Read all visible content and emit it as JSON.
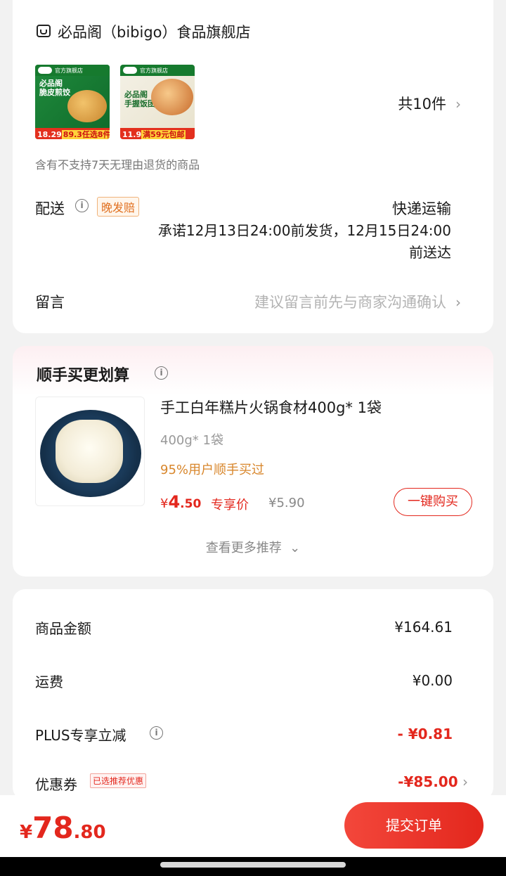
{
  "store": {
    "icon": "store-icon",
    "name": "必品阁（bibigo）食品旗舰店",
    "products": [
      {
        "header": "官方旗舰店",
        "title_line1": "必品阁",
        "title_line2": "脆皮煎饺",
        "price": "18.29",
        "promo": "89.3任选8件"
      },
      {
        "header": "官方旗舰店",
        "title_line1": "必品阁",
        "title_line2": "手握饭团",
        "price": "11.9",
        "promo": "满59元包邮"
      }
    ],
    "count": "共10件",
    "return_note": "含有不支持7天无理由退货的商品"
  },
  "delivery": {
    "label": "配送",
    "badge": "晚发赔",
    "method": "快递运输",
    "promise_line1": "承诺12月13日24:00前发货，12月15日24:00",
    "promise_line2": "前送达"
  },
  "message": {
    "label": "留言",
    "placeholder": "建议留言前先与商家沟通确认"
  },
  "recommend": {
    "title": "顺手买更划算",
    "item": {
      "name": "手工白年糕片火锅食材400g* 1袋",
      "spec": "400g* 1袋",
      "stat": "95%用户顺手买过",
      "currency": "¥",
      "price_int": "4",
      "price_dec": ".50",
      "exclusive_label": "专享价",
      "original_price": "¥5.90",
      "buy_label": "一键购买"
    },
    "more_label": "查看更多推荐"
  },
  "price_summary": {
    "goods_label": "商品金额",
    "goods_value": "¥164.61",
    "shipping_label": "运费",
    "shipping_value": "¥0.00",
    "plus_label": "PLUS专享立减",
    "plus_value": "- ¥0.81",
    "coupon_label": "优惠券",
    "coupon_badge": "已选推荐优惠",
    "coupon_value": "-¥85.00"
  },
  "footer": {
    "currency": "¥",
    "total_int": "78",
    "total_dec": ".80",
    "submit_label": "提交订单"
  },
  "colors": {
    "accent_red": "#e3271d",
    "orange": "#d8862b"
  }
}
